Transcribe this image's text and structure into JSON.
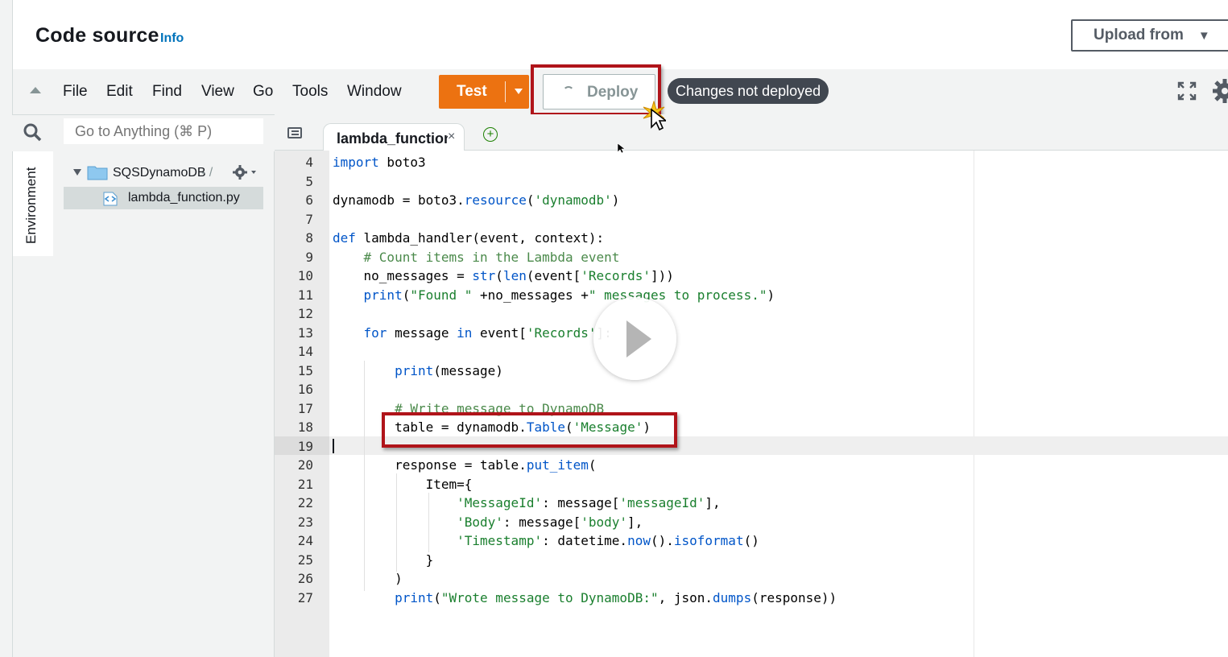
{
  "header": {
    "title": "Code source",
    "info_link": "Info",
    "upload_button": "Upload from"
  },
  "menubar": {
    "items": [
      "File",
      "Edit",
      "Find",
      "View",
      "Go",
      "Tools",
      "Window"
    ],
    "test_button": "Test",
    "deploy_button": "Deploy",
    "status_badge": "Changes not deployed"
  },
  "sidebar": {
    "search_placeholder": "Go to Anything (⌘ P)",
    "environment_tab": "Environment",
    "project": {
      "name": "SQSDynamoDB",
      "path": "- /"
    },
    "files": [
      "lambda_function.py"
    ]
  },
  "editor": {
    "tab_label": "lambda_function",
    "tab_close": "×",
    "add_tab": "+",
    "line_numbers": [
      "4",
      "5",
      "6",
      "7",
      "8",
      "9",
      "10",
      "11",
      "12",
      "13",
      "14",
      "15",
      "16",
      "17",
      "18",
      "19",
      "20",
      "21",
      "22",
      "23",
      "24",
      "25",
      "26",
      "27"
    ],
    "lines": {
      "l4_kw": "import",
      "l4_rest": " boto3",
      "l6_a": "dynamodb = boto3.",
      "l6_fn": "resource",
      "l6_b": "(",
      "l6_str": "'dynamodb'",
      "l6_c": ")",
      "l8_kw": "def",
      "l8_rest": " lambda_handler(event, context):",
      "l9": "    # Count items in the Lambda event",
      "l10_a": "    no_messages = ",
      "l10_fn": "str",
      "l10_b": "(",
      "l10_fn2": "len",
      "l10_c": "(event[",
      "l10_str": "'Records'",
      "l10_d": "]))",
      "l11_fn": "    print",
      "l11_b": "(",
      "l11_str": "\"Found \"",
      "l11_c": " +no_messages +",
      "l11_str2": "\" messages to process.\"",
      "l11_d": ")",
      "l13_kw": "    for",
      "l13_a": " message ",
      "l13_kw2": "in",
      "l13_b": " event[",
      "l13_str": "'Records'",
      "l13_c": "]:",
      "l15_fn": "        print",
      "l15_rest": "(message)",
      "l17": "        # Write message to DynamoDB",
      "l18_a": "        table = dynamodb.",
      "l18_fn": "Table",
      "l18_b": "(",
      "l18_str": "'Message'",
      "l18_c": ")",
      "l20_a": "        response = table.",
      "l20_fn": "put_item",
      "l20_b": "(",
      "l21": "            Item={",
      "l22_str": "                'MessageId'",
      "l22_a": ": message[",
      "l22_str2": "'messageId'",
      "l22_b": "],",
      "l23_str": "                'Body'",
      "l23_a": ": message[",
      "l23_str2": "'body'",
      "l23_b": "],",
      "l24_str": "                'Timestamp'",
      "l24_a": ": datetime.",
      "l24_fn": "now",
      "l24_b": "().",
      "l24_fn2": "isoformat",
      "l24_c": "()",
      "l25": "            }",
      "l26": "        )",
      "l27_fn": "        print",
      "l27_a": "(",
      "l27_str": "\"Wrote message to DynamoDB:\"",
      "l27_b": ", json.",
      "l27_fn2": "dumps",
      "l27_c": "(response))"
    }
  },
  "colors": {
    "accent_orange": "#ec7211",
    "highlight_red": "#b0141a",
    "info_blue": "#0073bb"
  }
}
